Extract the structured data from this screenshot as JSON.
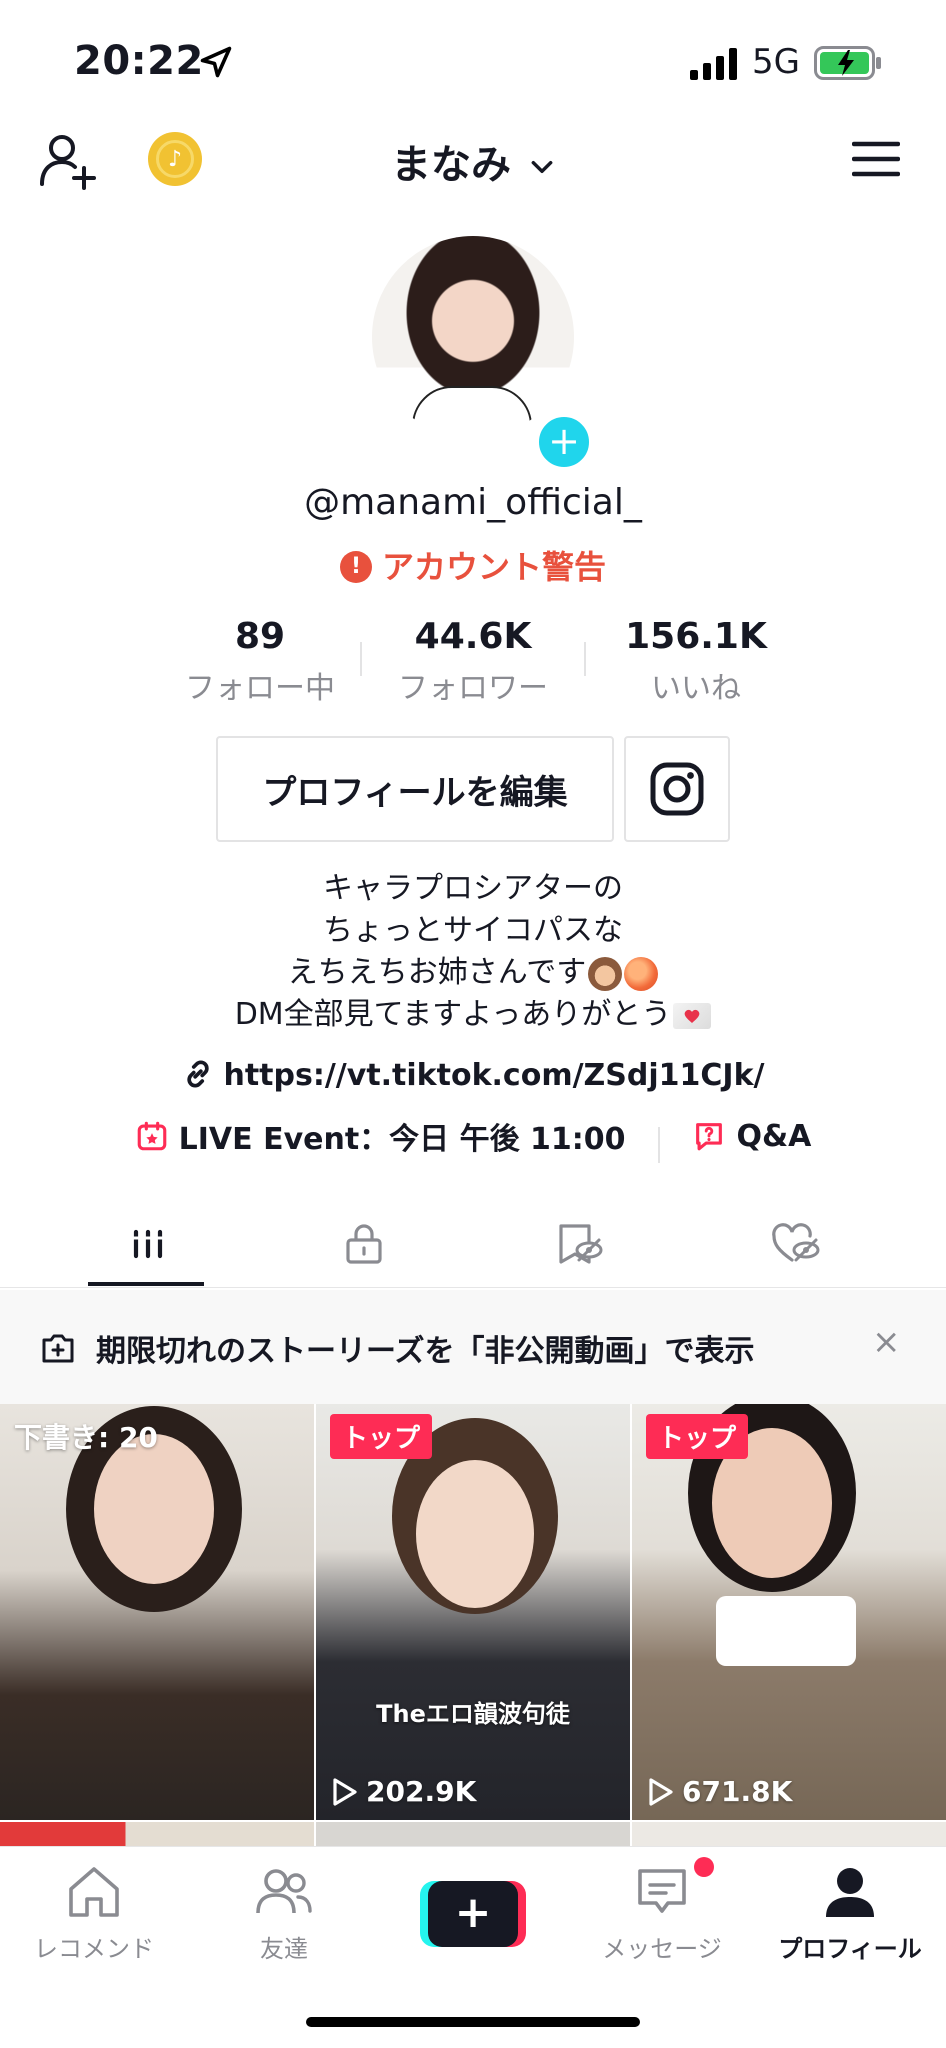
{
  "status_bar": {
    "time": "20:22",
    "network": "5G"
  },
  "header": {
    "username": "まなみ"
  },
  "profile": {
    "handle": "@manami_official_",
    "warning": "アカウント警告",
    "stats": [
      {
        "value": "89",
        "label": "フォロー中"
      },
      {
        "value": "44.6K",
        "label": "フォロワー"
      },
      {
        "value": "156.1K",
        "label": "いいね"
      }
    ],
    "edit_button": "プロフィールを編集",
    "bio_lines": [
      "キャラプロシアターの",
      "ちょっとサイコパスな",
      "えちえちお姉さんです",
      "DM全部見てますよっありがとう"
    ],
    "link": "https://vt.tiktok.com/ZSdj11CJk/",
    "live_event": "LIVE Event：今日 午後 11:00",
    "qa": "Q&A"
  },
  "tabs": [
    "videos-tab",
    "private-tab",
    "favorites-tab",
    "liked-tab"
  ],
  "story_banner": {
    "text": "期限切れのストーリーズを「非公開動画」で表示",
    "close": "×"
  },
  "videos": [
    {
      "label": "下書き: 20"
    },
    {
      "badge": "トップ",
      "plays": "202.9K",
      "caption": "Theエロ韻波句徒"
    },
    {
      "badge": "トップ",
      "plays": "671.8K"
    }
  ],
  "bottom_nav": [
    {
      "label": "レコメンド"
    },
    {
      "label": "友達"
    },
    {
      "label": "+"
    },
    {
      "label": "メッセージ"
    },
    {
      "label": "プロフィール"
    }
  ],
  "colors": {
    "accent": "#fe2c55",
    "warning": "#e8513d",
    "cyan": "#20d5ec"
  }
}
